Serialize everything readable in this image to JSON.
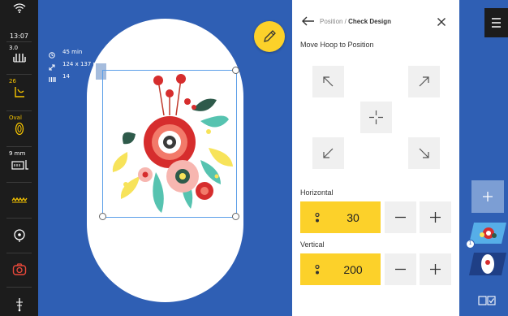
{
  "status": {
    "time": "13:07"
  },
  "toolbar": {
    "speed_value": "3.0",
    "tension_value": "26",
    "hoop_value": "Oval",
    "width_value": "9 mm"
  },
  "design_info": {
    "time": "45 min",
    "size": "124 x 137 mm",
    "colors": "14"
  },
  "panel": {
    "breadcrumb_parent": "Position / ",
    "breadcrumb_current": "Check Design",
    "section_title": "Move Hoop to Position",
    "horizontal_label": "Horizontal",
    "horizontal_value": "30",
    "vertical_label": "Vertical",
    "vertical_value": "200"
  },
  "thumbnails": {
    "badge": "1"
  },
  "colors": {
    "accent_yellow": "#fcd12a",
    "canvas_blue": "#2f5fb4",
    "toolbar_dark": "#1c1c1c"
  }
}
